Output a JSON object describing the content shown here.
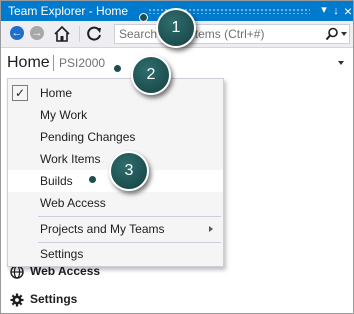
{
  "window": {
    "title": "Team Explorer - Home",
    "pin_glyph": "↓",
    "close_glyph": "×"
  },
  "toolbar": {
    "search_placeholder": "Search Work Items (Ctrl+#)",
    "icons": [
      "back-icon",
      "forward-icon",
      "home-icon",
      "refresh-icon",
      "search-icon"
    ],
    "accent": "#1e6fcc"
  },
  "header": {
    "title": "Home",
    "project": "PSI2000"
  },
  "menu": {
    "items": [
      {
        "label": "Home",
        "checked": true
      },
      {
        "label": "My Work"
      },
      {
        "label": "Pending Changes"
      },
      {
        "label": "Work Items"
      },
      {
        "label": "Builds",
        "highlighted": true
      },
      {
        "label": "Web Access"
      },
      {
        "label": "Projects and My Teams",
        "submenu": true
      },
      {
        "label": "Settings"
      }
    ],
    "check_glyph": "✓"
  },
  "page_links": [
    {
      "label": "Web Access",
      "icon": "globe-icon"
    },
    {
      "label": "Settings",
      "icon": "gear-icon"
    }
  ],
  "callouts": [
    "1",
    "2",
    "3"
  ],
  "colors": {
    "title_bar": "#007acc",
    "callout": "#1c4f4f"
  }
}
